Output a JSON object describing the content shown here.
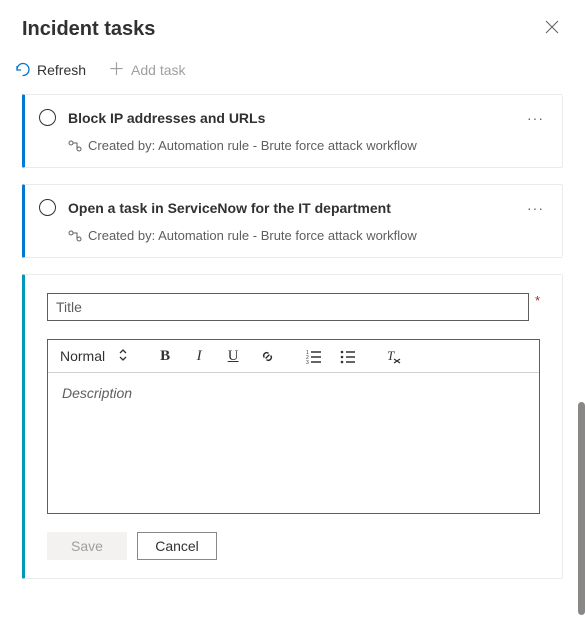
{
  "header": {
    "title": "Incident tasks"
  },
  "toolbar": {
    "refresh_label": "Refresh",
    "add_task_label": "Add task"
  },
  "tasks": [
    {
      "title": "Block IP addresses and URLs",
      "created_by": "Created by: Automation rule - Brute force attack workflow"
    },
    {
      "title": "Open a task in ServiceNow for the IT department",
      "created_by": "Created by: Automation rule - Brute force attack workflow"
    }
  ],
  "new_task": {
    "title_placeholder": "Title",
    "description_placeholder": "Description",
    "format_label": "Normal",
    "save_label": "Save",
    "cancel_label": "Cancel"
  }
}
